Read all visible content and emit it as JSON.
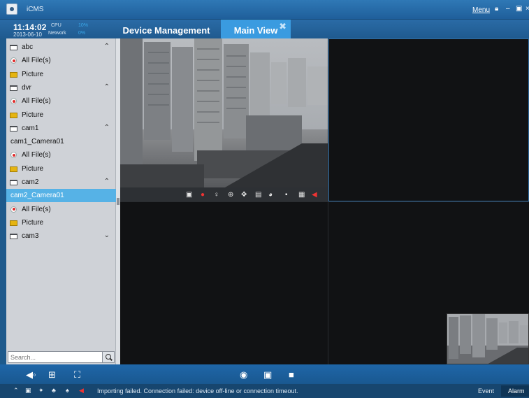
{
  "window": {
    "app_title": "iCMS",
    "menu_label": "Menu",
    "controls": [
      "lock-icon",
      "minimize-icon",
      "restore-icon",
      "close-icon"
    ]
  },
  "header": {
    "time": "11:14:02",
    "date": "2013-06-10",
    "cpu_label": "CPU",
    "cpu_value": "10%",
    "network_label": "Network",
    "network_value": "0%",
    "tabs": [
      {
        "label": "Device Management",
        "active": false
      },
      {
        "label": "Main View",
        "active": true,
        "closable": true
      }
    ]
  },
  "sidebar": {
    "items": [
      {
        "type": "device",
        "label": "abc",
        "icon": "folder-icon",
        "expanded": true
      },
      {
        "type": "record",
        "label": "All File(s)",
        "icon": "record-icon"
      },
      {
        "type": "picture",
        "label": "Picture",
        "icon": "picture-icon"
      },
      {
        "type": "device",
        "label": "dvr",
        "icon": "folder-icon",
        "expanded": true
      },
      {
        "type": "record",
        "label": "All File(s)",
        "icon": "record-icon"
      },
      {
        "type": "picture",
        "label": "Picture",
        "icon": "picture-icon"
      },
      {
        "type": "device",
        "label": "cam1",
        "icon": "folder-icon",
        "expanded": true
      },
      {
        "type": "camera",
        "label": "cam1_Camera01"
      },
      {
        "type": "record",
        "label": "All File(s)",
        "icon": "record-icon"
      },
      {
        "type": "picture",
        "label": "Picture",
        "icon": "picture-icon"
      },
      {
        "type": "device",
        "label": "cam2",
        "icon": "folder-icon",
        "expanded": true
      },
      {
        "type": "camera",
        "label": "cam2_Camera01",
        "selected": true
      },
      {
        "type": "record",
        "label": "All File(s)",
        "icon": "record-icon"
      },
      {
        "type": "picture",
        "label": "Picture",
        "icon": "picture-icon"
      },
      {
        "type": "device",
        "label": "cam3",
        "icon": "folder-icon",
        "expanded": false
      }
    ],
    "search_placeholder": "Search..."
  },
  "video_controls": [
    "snapshot-icon",
    "record-icon",
    "microphone-icon",
    "zoom-icon",
    "ptz-icon",
    "file-icon",
    "capture-icon",
    "stop-icon",
    "save-icon",
    "speaker-icon"
  ],
  "bottom_toolbar": [
    "volume-icon",
    "layout-icon",
    "fullscreen-icon",
    "record-all-icon",
    "snapshot-all-icon",
    "stop-all-icon"
  ],
  "status": {
    "message": "Importing failed. Connection failed: device off-line or connection timeout.",
    "event_label": "Event",
    "alarm_label": "Alarm"
  },
  "colors": {
    "accent": "#3a9be0",
    "selection": "#56b2e6",
    "frame": "#1e5a8c",
    "record_red": "#e02b2b"
  }
}
